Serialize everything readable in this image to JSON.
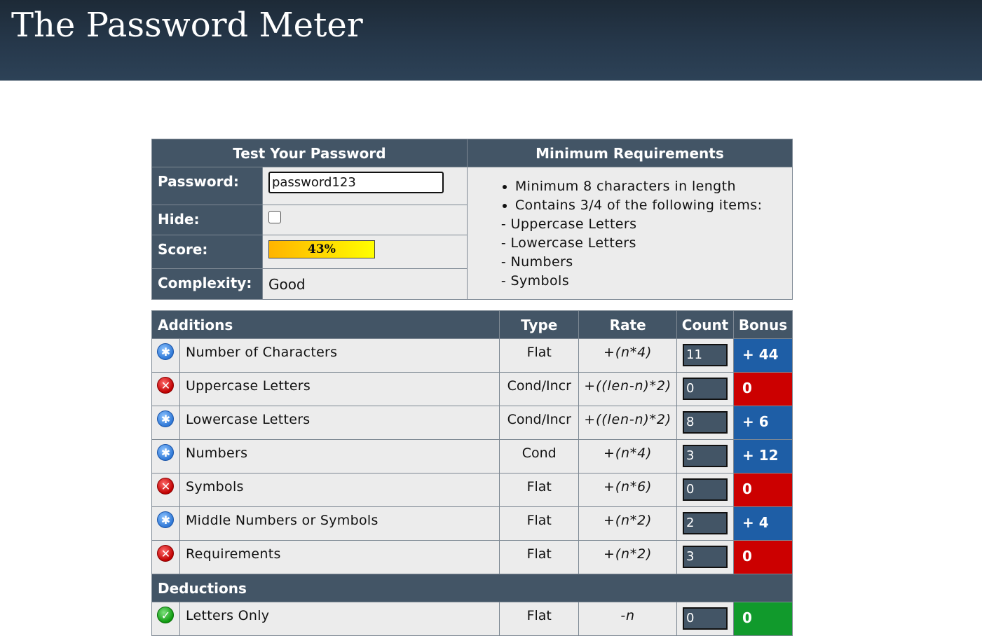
{
  "header": {
    "title": "The Password Meter"
  },
  "test": {
    "heading": "Test Your Password",
    "password_label": "Password:",
    "password_value": "password123",
    "hide_label": "Hide:",
    "score_label": "Score:",
    "score_value": "43%",
    "score_fraction": 0.43,
    "complexity_label": "Complexity:",
    "complexity_value": "Good"
  },
  "requirements": {
    "heading": "Minimum Requirements",
    "items": [
      "Minimum 8 characters in length",
      "Contains 3/4 of the following items:"
    ],
    "sub_items": [
      "- Uppercase Letters",
      "- Lowercase Letters",
      "- Numbers",
      "- Symbols"
    ]
  },
  "columns": {
    "additions": "Additions",
    "type": "Type",
    "rate": "Rate",
    "count": "Count",
    "bonus": "Bonus",
    "deductions": "Deductions"
  },
  "additions": [
    {
      "status": "pass",
      "icon": "pass-icon",
      "name": "Number of Characters",
      "type": "Flat",
      "rate": "+(n*4)",
      "count": "11",
      "bonus": "+ 44",
      "bonus_color": "#1e5ea6"
    },
    {
      "status": "fail",
      "icon": "fail-icon",
      "name": "Uppercase Letters",
      "type": "Cond/Incr",
      "rate": "+((len-n)*2)",
      "count": "0",
      "bonus": "0",
      "bonus_color": "#cc0000"
    },
    {
      "status": "pass",
      "icon": "pass-icon",
      "name": "Lowercase Letters",
      "type": "Cond/Incr",
      "rate": "+((len-n)*2)",
      "count": "8",
      "bonus": "+ 6",
      "bonus_color": "#1e5ea6"
    },
    {
      "status": "pass",
      "icon": "pass-icon",
      "name": "Numbers",
      "type": "Cond",
      "rate": "+(n*4)",
      "count": "3",
      "bonus": "+ 12",
      "bonus_color": "#1e5ea6"
    },
    {
      "status": "fail",
      "icon": "fail-icon",
      "name": "Symbols",
      "type": "Flat",
      "rate": "+(n*6)",
      "count": "0",
      "bonus": "0",
      "bonus_color": "#cc0000"
    },
    {
      "status": "pass",
      "icon": "pass-icon",
      "name": "Middle Numbers or Symbols",
      "type": "Flat",
      "rate": "+(n*2)",
      "count": "2",
      "bonus": "+ 4",
      "bonus_color": "#1e5ea6"
    },
    {
      "status": "fail",
      "icon": "fail-icon",
      "name": "Requirements",
      "type": "Flat",
      "rate": "+(n*2)",
      "count": "3",
      "bonus": "0",
      "bonus_color": "#cc0000"
    }
  ],
  "deductions": [
    {
      "status": "ok",
      "icon": "check-icon",
      "name": "Letters Only",
      "type": "Flat",
      "rate": "-n",
      "count": "0",
      "bonus": "0",
      "bonus_color": "#119a2c"
    }
  ]
}
